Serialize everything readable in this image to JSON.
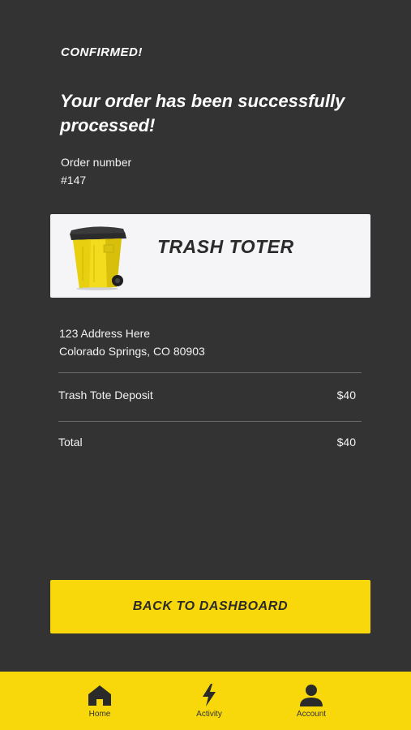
{
  "status_label": "CONFIRMED!",
  "headline": "Your order has been successfully processed!",
  "order": {
    "label": "Order number",
    "number": "#147"
  },
  "product": {
    "name": "TRASH TOTER",
    "image_icon": "yellow-trash-bin-icon"
  },
  "address": {
    "line1": "123 Address Here",
    "line2": "Colorado Springs, CO 80903"
  },
  "line_items": [
    {
      "label": "Trash Tote Deposit",
      "amount": "$40"
    }
  ],
  "total": {
    "label": "Total",
    "amount": "$40"
  },
  "primary_button": {
    "label": "BACK TO DASHBOARD"
  },
  "bottom_nav": [
    {
      "label": "Home",
      "icon": "home-icon"
    },
    {
      "label": "Activity",
      "icon": "lightning-icon"
    },
    {
      "label": "Account",
      "icon": "person-icon"
    }
  ],
  "colors": {
    "background": "#333333",
    "accent": "#f8d80a",
    "card": "#f5f5f7",
    "text_dark": "#2a2a2a"
  }
}
